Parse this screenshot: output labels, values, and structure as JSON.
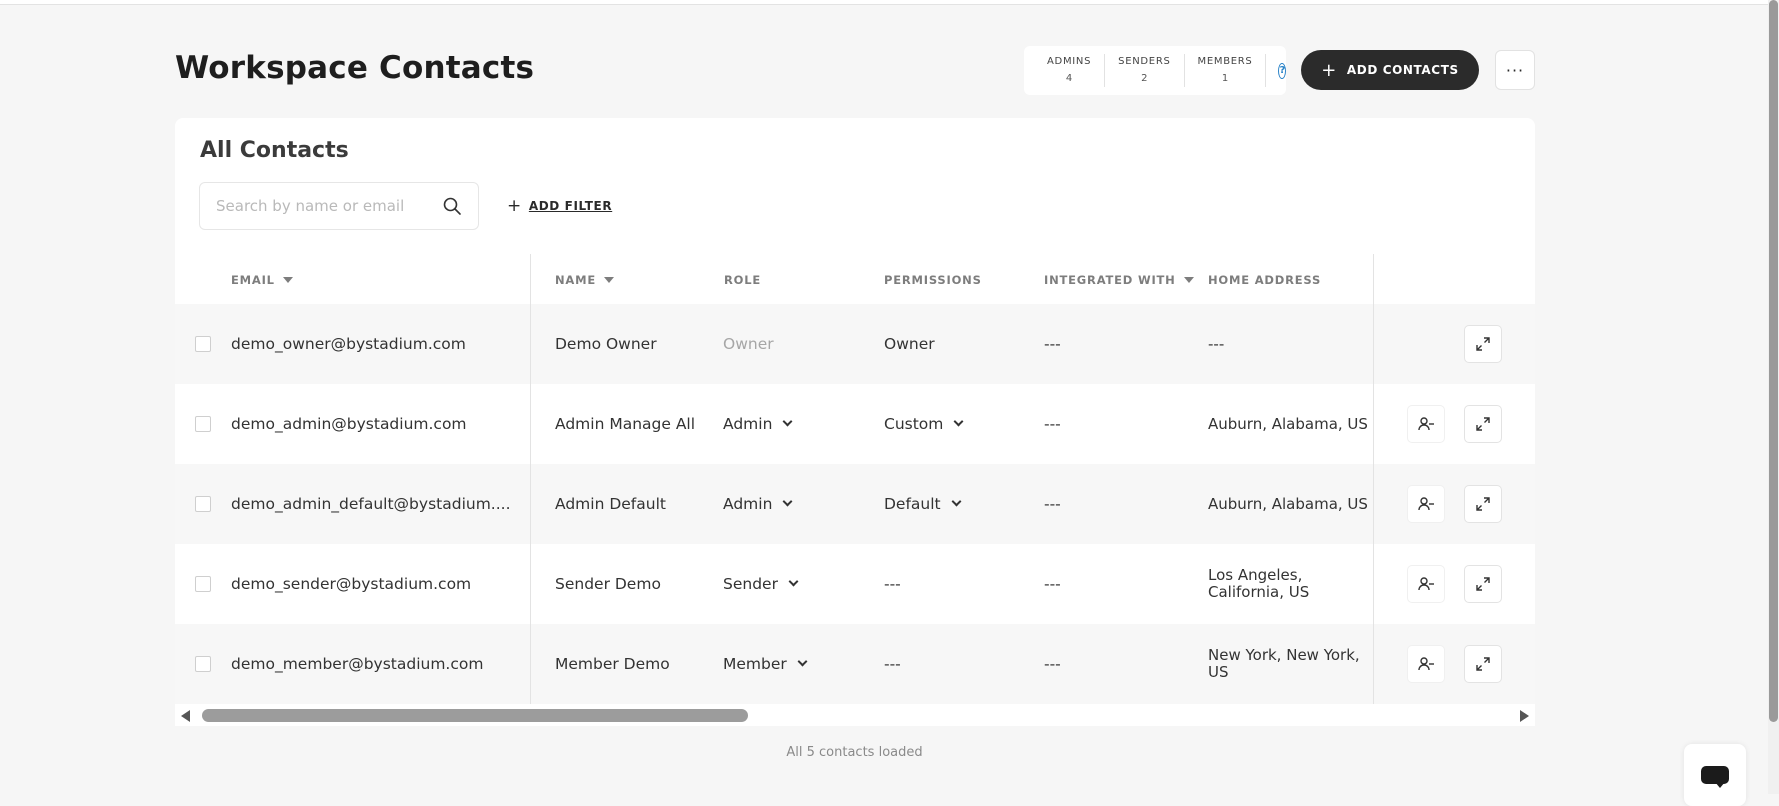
{
  "page": {
    "title": "Workspace Contacts"
  },
  "stats": [
    {
      "label": "ADMINS",
      "value": "4"
    },
    {
      "label": "SENDERS",
      "value": "2"
    },
    {
      "label": "MEMBERS",
      "value": "1"
    }
  ],
  "help": {
    "glyph": "?"
  },
  "actions": {
    "add_contacts": "ADD CONTACTS",
    "plus": "+",
    "more": "···"
  },
  "card": {
    "title": "All Contacts",
    "search_placeholder": "Search by name or email",
    "add_filter": "ADD FILTER"
  },
  "table": {
    "headers": {
      "email": "EMAIL",
      "name": "NAME",
      "role": "ROLE",
      "permissions": "PERMISSIONS",
      "integrated_with": "INTEGRATED WITH",
      "home_address": "HOME ADDRESS"
    },
    "rows": [
      {
        "email": "demo_owner@bystadium.com",
        "name": "Demo Owner",
        "role": "Owner",
        "permissions": "Owner",
        "integrated": "---",
        "address": "---"
      },
      {
        "email": "demo_admin@bystadium.com",
        "name": "Admin Manage All",
        "role": "Admin",
        "permissions": "Custom",
        "integrated": "---",
        "address": "Auburn, Alabama, US"
      },
      {
        "email": "demo_admin_default@bystadium....",
        "name": "Admin Default",
        "role": "Admin",
        "permissions": "Default",
        "integrated": "---",
        "address": "Auburn, Alabama, US"
      },
      {
        "email": "demo_sender@bystadium.com",
        "name": "Sender Demo",
        "role": "Sender",
        "permissions": "---",
        "integrated": "---",
        "address": "Los Angeles, California, US"
      },
      {
        "email": "demo_member@bystadium.com",
        "name": "Member Demo",
        "role": "Member",
        "permissions": "---",
        "integrated": "---",
        "address": "New York, New York, US"
      }
    ]
  },
  "footer": {
    "status": "All 5 contacts loaded"
  },
  "colors": {
    "primary_button": "#2b2b2b",
    "help_accent": "#2a83c8",
    "row_alt": "#f7f7f7"
  },
  "icons": {
    "search": "search-icon",
    "expand": "expand-icon",
    "remove_user": "user-minus-icon",
    "chat": "chat-icon"
  }
}
